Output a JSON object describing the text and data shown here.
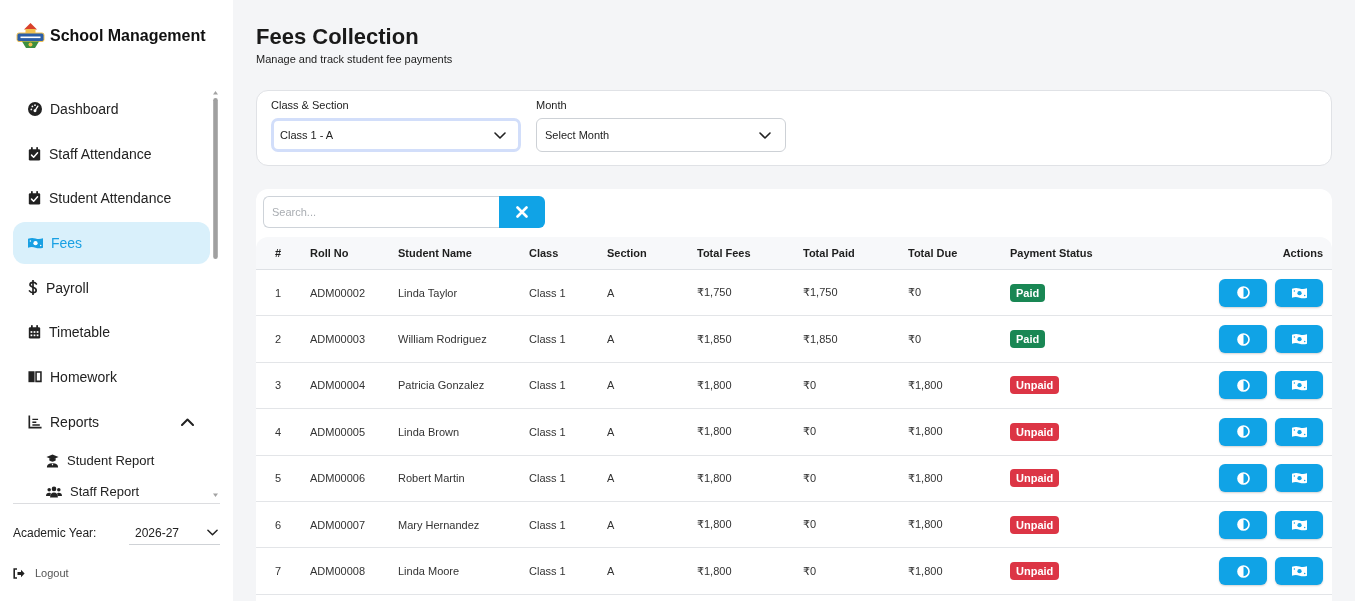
{
  "sidebar": {
    "brand": "School Management",
    "nav": [
      {
        "label": "Dashboard",
        "selected": false
      },
      {
        "label": "Staff Attendance",
        "selected": false
      },
      {
        "label": "Student Attendance",
        "selected": false
      },
      {
        "label": "Fees",
        "selected": true
      },
      {
        "label": "Payroll",
        "selected": false
      },
      {
        "label": "Timetable",
        "selected": false
      },
      {
        "label": "Homework",
        "selected": false
      },
      {
        "label": "Reports",
        "selected": false,
        "expanded": true,
        "children": [
          {
            "label": "Student Report",
            "selected": false
          },
          {
            "label": "Staff Report",
            "selected": false
          }
        ]
      }
    ],
    "academic_year": {
      "label": "Academic Year:",
      "value": "2026-27"
    },
    "logout": "Logout"
  },
  "page": {
    "title": "Fees Collection",
    "subtitle": "Manage and track student fee payments"
  },
  "filters": [
    {
      "label": "Class & Section",
      "value": "Class 1 - A",
      "focused": true
    },
    {
      "label": "Month",
      "value": "Select Month",
      "focused": false
    }
  ],
  "search": {
    "placeholder": "Search..."
  },
  "table": {
    "columns": [
      "#",
      "Roll No",
      "Student Name",
      "Class",
      "Section",
      "Total Fees",
      "Total Paid",
      "Total Due",
      "Payment Status",
      "Actions"
    ],
    "rows": [
      {
        "number": "1",
        "roll_no": "ADM00002",
        "student_name": "Linda Taylor",
        "class": "Class 1",
        "section": "A",
        "total_fees": "₹1,750",
        "total_paid": "₹1,750",
        "total_due": "₹0",
        "status": "Paid",
        "paid": true
      },
      {
        "number": "2",
        "roll_no": "ADM00003",
        "student_name": "William Rodriguez",
        "class": "Class 1",
        "section": "A",
        "total_fees": "₹1,850",
        "total_paid": "₹1,850",
        "total_due": "₹0",
        "status": "Paid",
        "paid": true
      },
      {
        "number": "3",
        "roll_no": "ADM00004",
        "student_name": "Patricia Gonzalez",
        "class": "Class 1",
        "section": "A",
        "total_fees": "₹1,800",
        "total_paid": "₹0",
        "total_due": "₹1,800",
        "status": "Unpaid",
        "paid": false
      },
      {
        "number": "4",
        "roll_no": "ADM00005",
        "student_name": "Linda Brown",
        "class": "Class 1",
        "section": "A",
        "total_fees": "₹1,800",
        "total_paid": "₹0",
        "total_due": "₹1,800",
        "status": "Unpaid",
        "paid": false
      },
      {
        "number": "5",
        "roll_no": "ADM00006",
        "student_name": "Robert Martin",
        "class": "Class 1",
        "section": "A",
        "total_fees": "₹1,800",
        "total_paid": "₹0",
        "total_due": "₹1,800",
        "status": "Unpaid",
        "paid": false
      },
      {
        "number": "6",
        "roll_no": "ADM00007",
        "student_name": "Mary Hernandez",
        "class": "Class 1",
        "section": "A",
        "total_fees": "₹1,800",
        "total_paid": "₹0",
        "total_due": "₹1,800",
        "status": "Unpaid",
        "paid": false
      },
      {
        "number": "7",
        "roll_no": "ADM00008",
        "student_name": "Linda Moore",
        "class": "Class 1",
        "section": "A",
        "total_fees": "₹1,800",
        "total_paid": "₹0",
        "total_due": "₹1,800",
        "status": "Unpaid",
        "paid": false
      }
    ]
  }
}
